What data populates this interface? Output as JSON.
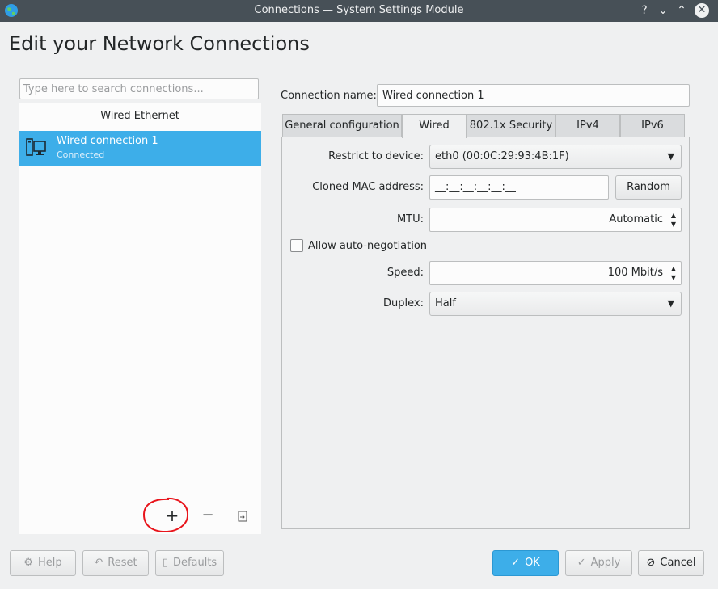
{
  "window": {
    "title": "Connections — System Settings Module",
    "help_glyph": "?",
    "minimize_glyph": "⌄",
    "maximize_glyph": "⌃",
    "close_glyph": "✕"
  },
  "page": {
    "heading": "Edit your Network Connections"
  },
  "sidebar": {
    "search_placeholder": "Type here to search connections...",
    "group_label": "Wired Ethernet",
    "connections": [
      {
        "name": "Wired connection 1",
        "status": "Connected",
        "icon": "computer-icon",
        "selected": true
      }
    ],
    "tools": {
      "add": "+",
      "remove": "−",
      "export_icon": "export-icon"
    }
  },
  "editor": {
    "connection_name_label": "Connection name:",
    "connection_name_value": "Wired connection 1",
    "tabs": [
      {
        "label": "General configuration",
        "active": false
      },
      {
        "label": "Wired",
        "active": true
      },
      {
        "label": "802.1x Security",
        "active": false
      },
      {
        "label": "IPv4",
        "active": false
      },
      {
        "label": "IPv6",
        "active": false
      }
    ],
    "wired": {
      "restrict_label": "Restrict to device:",
      "restrict_value": "eth0 (00:0C:29:93:4B:1F)",
      "cloned_mac_label": "Cloned MAC address:",
      "cloned_mac_value": "__:__:__:__:__:__",
      "random_button": "Random",
      "mtu_label": "MTU:",
      "mtu_value": "Automatic",
      "auto_negotiation_label": "Allow auto-negotiation",
      "auto_negotiation_checked": false,
      "speed_label": "Speed:",
      "speed_value": "100 Mbit/s",
      "duplex_label": "Duplex:",
      "duplex_value": "Half"
    }
  },
  "footer": {
    "help": "Help",
    "reset": "Reset",
    "defaults": "Defaults",
    "ok": "OK",
    "apply": "Apply",
    "cancel": "Cancel"
  },
  "colors": {
    "titlebar": "#475057",
    "selection": "#3daee9",
    "annotation": "#e8141b"
  }
}
